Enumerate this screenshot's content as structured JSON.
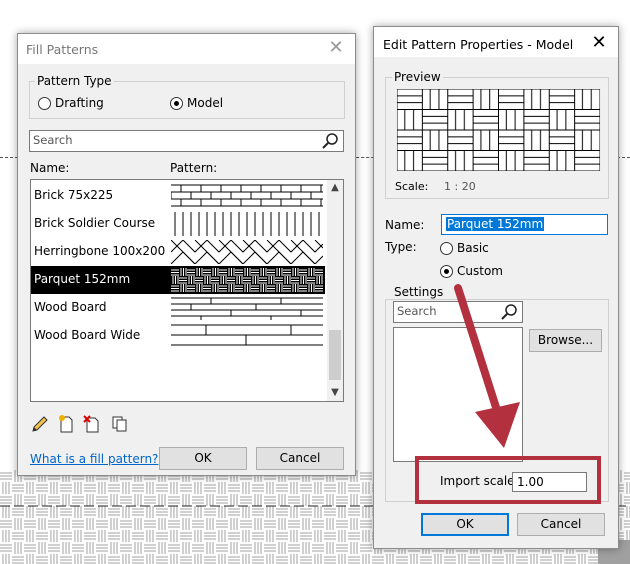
{
  "fill_patterns": {
    "title": "Fill Patterns",
    "pattern_type_label": "Pattern Type",
    "radio_drafting": "Drafting",
    "radio_model": "Model",
    "search_placeholder": "Search",
    "col_name": "Name:",
    "col_pattern": "Pattern:",
    "items": [
      {
        "name": "Brick 75x225"
      },
      {
        "name": "Brick Soldier Course"
      },
      {
        "name": "Herringbone 100x200"
      },
      {
        "name": "Parquet 152mm",
        "selected": true
      },
      {
        "name": "Wood Board"
      },
      {
        "name": "Wood Board Wide"
      }
    ],
    "help_link": "What is a fill pattern?",
    "ok": "OK",
    "cancel": "Cancel",
    "tool_icons": [
      "pencil-icon",
      "new-pattern-icon",
      "delete-pattern-icon",
      "duplicate-icon"
    ]
  },
  "edit_pattern": {
    "title": "Edit Pattern Properties - Model",
    "preview_label": "Preview",
    "scale_label": "Scale:",
    "scale_value": "1 : 20",
    "name_label": "Name:",
    "name_value": "Parquet 152mm",
    "type_label": "Type:",
    "radio_basic": "Basic",
    "radio_custom": "Custom",
    "settings_label": "Settings",
    "search_placeholder": "Search",
    "browse": "Browse...",
    "import_scale_label": "Import scale",
    "import_scale_value": "1.00",
    "ok": "OK",
    "cancel": "Cancel"
  },
  "colors": {
    "annotation_red": "#b3303f",
    "selection": "#000000",
    "highlight": "#0078d7"
  }
}
